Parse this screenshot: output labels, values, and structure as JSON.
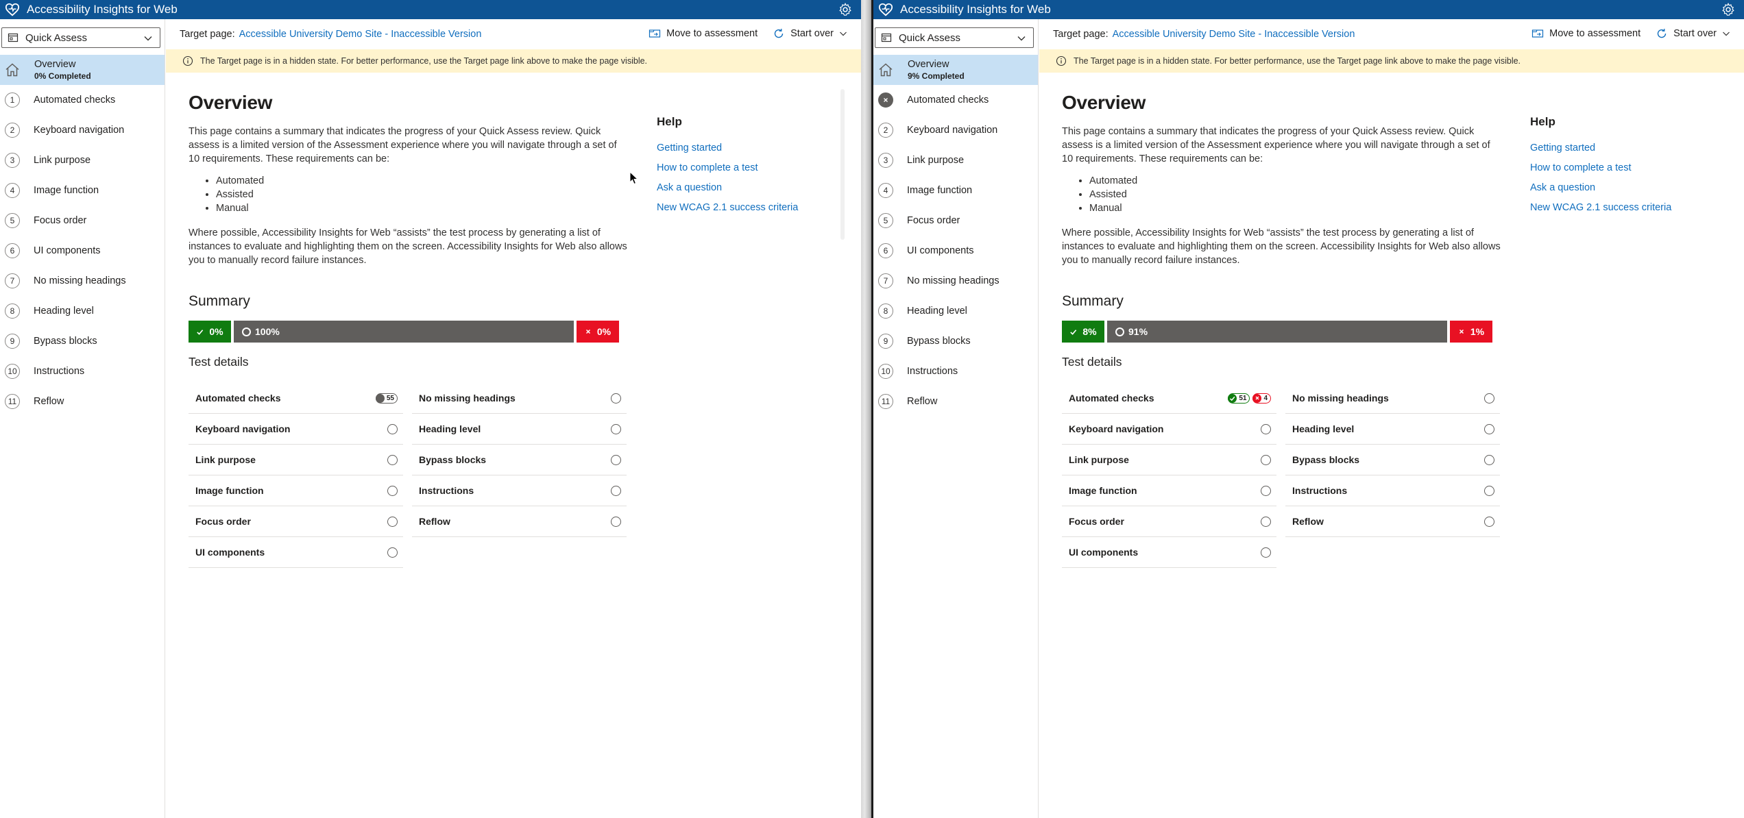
{
  "app": {
    "title": "Accessibility Insights for Web",
    "accent": "#0e5494"
  },
  "colors": {
    "pass": "#107c10",
    "fail": "#e81123",
    "incomplete": "#605e5c",
    "warning_bg": "#fff4ce",
    "selected_nav": "#c7e0f4",
    "link": "#106ebe"
  },
  "icons": {
    "logo": "heart-icon",
    "settings": "gear-icon",
    "mode": "quick-assess-icon",
    "home": "home-icon",
    "info": "info-icon",
    "move": "move-to-assessment-icon",
    "start_over": "refresh-icon",
    "chevron": "chevron-down-icon"
  },
  "windows": [
    {
      "mode_select": "Quick Assess",
      "target_label": "Target page:",
      "target_link": "Accessible University Demo Site - Inaccessible Version",
      "move_to_assessment": "Move to assessment",
      "start_over": "Start over",
      "warning": "The Target page is in a hidden state. For better performance, use the Target page link above to make the page visible.",
      "nav": {
        "overview_label": "Overview",
        "overview_progress": "0% Completed",
        "items": [
          {
            "num": "1",
            "label": "Automated checks",
            "status": "none"
          },
          {
            "num": "2",
            "label": "Keyboard navigation",
            "status": "none"
          },
          {
            "num": "3",
            "label": "Link purpose",
            "status": "none"
          },
          {
            "num": "4",
            "label": "Image function",
            "status": "none"
          },
          {
            "num": "5",
            "label": "Focus order",
            "status": "none"
          },
          {
            "num": "6",
            "label": "UI components",
            "status": "none"
          },
          {
            "num": "7",
            "label": "No missing headings",
            "status": "none"
          },
          {
            "num": "8",
            "label": "Heading level",
            "status": "none"
          },
          {
            "num": "9",
            "label": "Bypass blocks",
            "status": "none"
          },
          {
            "num": "10",
            "label": "Instructions",
            "status": "none"
          },
          {
            "num": "11",
            "label": "Reflow",
            "status": "none"
          }
        ]
      },
      "main": {
        "title": "Overview",
        "intro": "This page contains a summary that indicates the progress of your Quick Assess review. Quick assess is a limited version of the Assessment experience where you will navigate through a set of 10 requirements. These requirements can be:",
        "requirement_types": [
          "Automated",
          "Assisted",
          "Manual"
        ],
        "assist_text": "Where possible, Accessibility Insights for Web “assists” the test process by generating a list of instances to evaluate and highlighting them on the screen. Accessibility Insights for Web also allows you to manually record failure instances.",
        "summary_title": "Summary",
        "summary": {
          "pass": "0%",
          "incomplete": "100%",
          "fail": "0%",
          "pass_pct": 0,
          "incomplete_pct": 100,
          "fail_pct": 0
        },
        "test_details_title": "Test details",
        "tests_col1": [
          {
            "label": "Automated checks",
            "badges": [
              {
                "kind": "neutral",
                "text": "55"
              }
            ]
          },
          {
            "label": "Keyboard navigation",
            "badges": []
          },
          {
            "label": "Link purpose",
            "badges": []
          },
          {
            "label": "Image function",
            "badges": []
          },
          {
            "label": "Focus order",
            "badges": []
          },
          {
            "label": "UI components",
            "badges": []
          }
        ],
        "tests_col2": [
          {
            "label": "No missing headings"
          },
          {
            "label": "Heading level"
          },
          {
            "label": "Bypass blocks"
          },
          {
            "label": "Instructions"
          },
          {
            "label": "Reflow"
          }
        ]
      },
      "help": {
        "title": "Help",
        "links": [
          "Getting started",
          "How to complete a test",
          "Ask a question",
          "New WCAG 2.1 success criteria"
        ]
      }
    },
    {
      "mode_select": "Quick Assess",
      "target_label": "Target page:",
      "target_link": "Accessible University Demo Site - Inaccessible Version",
      "move_to_assessment": "Move to assessment",
      "start_over": "Start over",
      "warning": "The Target page is in a hidden state. For better performance, use the Target page link above to make the page visible.",
      "nav": {
        "overview_label": "Overview",
        "overview_progress": "9% Completed",
        "items": [
          {
            "num": "",
            "label": "Automated checks",
            "status": "fail"
          },
          {
            "num": "2",
            "label": "Keyboard navigation",
            "status": "none"
          },
          {
            "num": "3",
            "label": "Link purpose",
            "status": "none"
          },
          {
            "num": "4",
            "label": "Image function",
            "status": "none"
          },
          {
            "num": "5",
            "label": "Focus order",
            "status": "none"
          },
          {
            "num": "6",
            "label": "UI components",
            "status": "none"
          },
          {
            "num": "7",
            "label": "No missing headings",
            "status": "none"
          },
          {
            "num": "8",
            "label": "Heading level",
            "status": "none"
          },
          {
            "num": "9",
            "label": "Bypass blocks",
            "status": "none"
          },
          {
            "num": "10",
            "label": "Instructions",
            "status": "none"
          },
          {
            "num": "11",
            "label": "Reflow",
            "status": "none"
          }
        ]
      },
      "main": {
        "title": "Overview",
        "intro": "This page contains a summary that indicates the progress of your Quick Assess review. Quick assess is a limited version of the Assessment experience where you will navigate through a set of 10 requirements. These requirements can be:",
        "requirement_types": [
          "Automated",
          "Assisted",
          "Manual"
        ],
        "assist_text": "Where possible, Accessibility Insights for Web “assists” the test process by generating a list of instances to evaluate and highlighting them on the screen. Accessibility Insights for Web also allows you to manually record failure instances.",
        "summary_title": "Summary",
        "summary": {
          "pass": "8%",
          "incomplete": "91%",
          "fail": "1%",
          "pass_pct": 8,
          "incomplete_pct": 91,
          "fail_pct": 1
        },
        "test_details_title": "Test details",
        "tests_col1": [
          {
            "label": "Automated checks",
            "badges": [
              {
                "kind": "pass",
                "text": "51"
              },
              {
                "kind": "fail",
                "text": "4"
              }
            ]
          },
          {
            "label": "Keyboard navigation",
            "badges": []
          },
          {
            "label": "Link purpose",
            "badges": []
          },
          {
            "label": "Image function",
            "badges": []
          },
          {
            "label": "Focus order",
            "badges": []
          },
          {
            "label": "UI components",
            "badges": []
          }
        ],
        "tests_col2": [
          {
            "label": "No missing headings"
          },
          {
            "label": "Heading level"
          },
          {
            "label": "Bypass blocks"
          },
          {
            "label": "Instructions"
          },
          {
            "label": "Reflow"
          }
        ]
      },
      "help": {
        "title": "Help",
        "links": [
          "Getting started",
          "How to complete a test",
          "Ask a question",
          "New WCAG 2.1 success criteria"
        ]
      }
    }
  ]
}
